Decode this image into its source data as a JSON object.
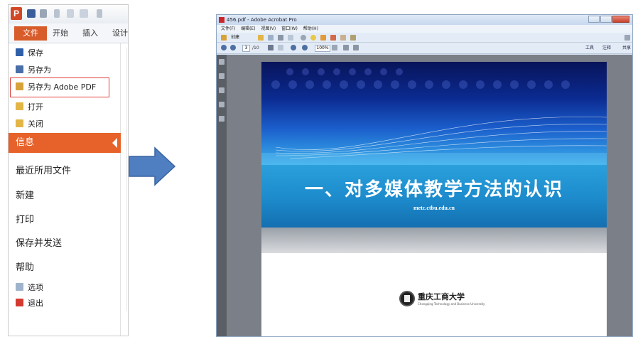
{
  "left": {
    "qat_logo": "P",
    "tabs": {
      "file": "文件",
      "home": "开始",
      "insert": "插入",
      "design": "设计"
    },
    "menu": {
      "save": "保存",
      "save_as": "另存为",
      "save_as_pdf": "另存为 Adobe PDF",
      "open": "打开",
      "close": "关闭",
      "info": "信息",
      "recent": "最近所用文件",
      "new": "新建",
      "print": "打印",
      "save_send": "保存并发送",
      "help": "帮助",
      "options": "选项",
      "exit": "退出"
    }
  },
  "acrobat": {
    "title": "456.pdf - Adobe Acrobat Pro",
    "menu": [
      "文件(F)",
      "编辑(E)",
      "视图(V)",
      "窗口(W)",
      "帮助(H)"
    ],
    "create_label": "创建",
    "page_current": "3",
    "page_total": "/10",
    "zoom": "100%",
    "right_buttons": {
      "tools": "工具",
      "comment": "注释",
      "share": "共享"
    },
    "slide": {
      "title": "一、对多媒体教学方法的认识",
      "url": "metc.ctbu.edu.cn",
      "logo_text": "重庆工商大学",
      "logo_sub": "Chongqing Technology and Business University"
    }
  },
  "colors": {
    "accent_orange": "#e6622a",
    "highlight_red": "#e0403a",
    "arrow_blue": "#4f7fc0"
  }
}
